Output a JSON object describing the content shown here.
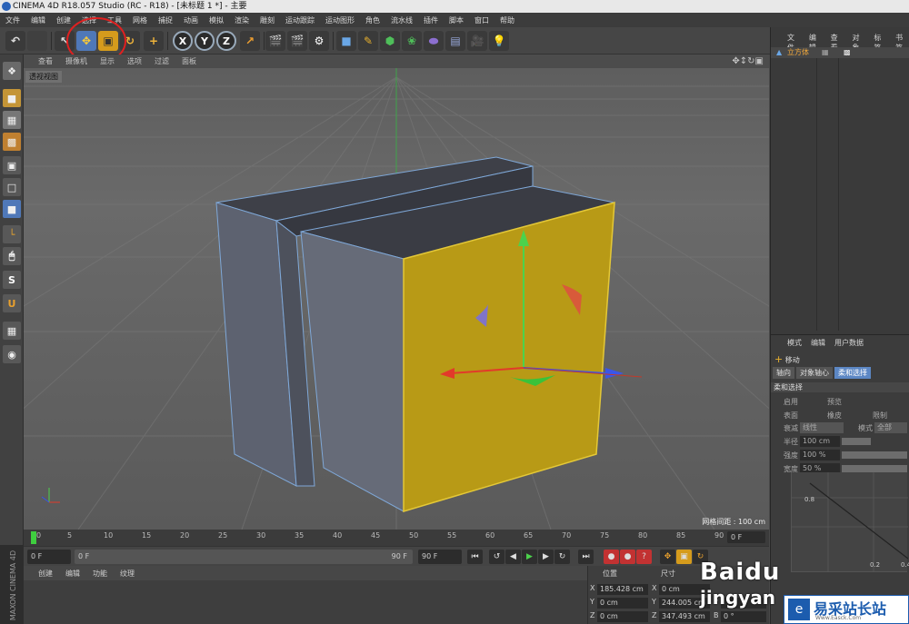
{
  "window": {
    "title": "CINEMA 4D R18.057 Studio (RC - R18) - [未标题 1 *] - 主要"
  },
  "menubar": [
    "文件",
    "编辑",
    "创建",
    "选择",
    "工具",
    "网格",
    "捕捉",
    "动画",
    "模拟",
    "渲染",
    "雕刻",
    "运动跟踪",
    "运动图形",
    "角色",
    "流水线",
    "插件",
    "脚本",
    "窗口",
    "帮助"
  ],
  "toolbar": {
    "axis_x": "X",
    "axis_y": "Y",
    "axis_z": "Z"
  },
  "viewport": {
    "menu": [
      "查看",
      "摄像机",
      "显示",
      "选项",
      "过滤",
      "面板"
    ],
    "label": "透视视图",
    "grid_info": "网格间距 : 100 cm"
  },
  "timeline": {
    "ticks": [
      "0",
      "5",
      "10",
      "15",
      "20",
      "25",
      "30",
      "35",
      "40",
      "45",
      "50",
      "55",
      "60",
      "65",
      "70",
      "75",
      "80",
      "85",
      "90"
    ],
    "end_frame_field": "0 F",
    "current_frame": "0 F",
    "range_start": "0 F",
    "range_end": "90 F",
    "max_frame": "90 F"
  },
  "material": {
    "menu": [
      "创建",
      "编辑",
      "功能",
      "纹理"
    ]
  },
  "coords": {
    "headers": [
      "位置",
      "尺寸"
    ],
    "rows": [
      {
        "axis": "X",
        "pos": "185.428 cm",
        "axis2": "X",
        "size": "0 cm"
      },
      {
        "axis": "Y",
        "pos": "0 cm",
        "axis2": "Y",
        "size": "244.005 cm",
        "axis3": "P"
      },
      {
        "axis": "Z",
        "pos": "0 cm",
        "axis2": "Z",
        "size": "347.493 cm",
        "axis3": "B",
        "rot": "0 °"
      }
    ]
  },
  "objects": {
    "menu": [
      "文件",
      "编辑",
      "查看",
      "对象",
      "标签",
      "书签"
    ],
    "item": "立方体"
  },
  "attributes": {
    "menu": [
      "模式",
      "编辑",
      "用户数据"
    ],
    "tool": "移动",
    "tabs": [
      "轴向",
      "对象轴心",
      "柔和选择"
    ],
    "section": "柔和选择",
    "enable": "启用",
    "preview": "预览",
    "surface": "表面",
    "rubber": "橡皮",
    "restrict": "限制",
    "falloff": "衰减",
    "falloff_val": "线性",
    "mode": "模式",
    "mode_val": "全部",
    "radius": "半径",
    "radius_val": "100 cm",
    "strength": "强度",
    "strength_val": "100 %",
    "width": "宽度",
    "width_val": "50 %",
    "graph_y": "0.8",
    "graph_x1": "0.2",
    "graph_x2": "0.4"
  },
  "sidebar": {
    "brand": "MAXON CINEMA 4D"
  },
  "watermark": {
    "baidu": "Baidu",
    "jingyan": "jingyan",
    "site_name": "易采站长站",
    "site_url": "Www.Easck.Com"
  }
}
